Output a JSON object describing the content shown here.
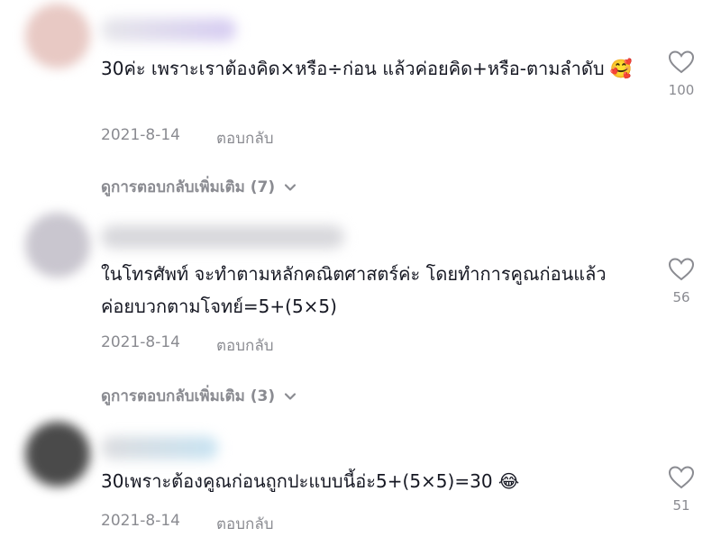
{
  "comments": [
    {
      "text": "30ค่ะ เพราะเราต้องคิด×หรือ÷ก่อน แล้วค่อยคิด+หรือ-ตามลำดับ",
      "emoji": "🥰",
      "date": "2021-8-14",
      "reply_label": "ตอบกลับ",
      "likes": "100",
      "more_replies": "ดูการตอบกลับเพิ่มเติม (7)",
      "avatar_color": "#e8c9c4",
      "name_color": "#d6ccf2"
    },
    {
      "text": "ในโทรศัพท์ จะทำตามหลักคณิตศาสตร์ค่ะ โดยทำการคูณก่อนแล้วค่อยบวกตามโจทย์=5+(5×5)",
      "emoji": "",
      "date": "2021-8-14",
      "reply_label": "ตอบกลับ",
      "likes": "56",
      "more_replies": "ดูการตอบกลับเพิ่มเติม (3)",
      "avatar_color": "#c9c6cf",
      "name_color": "#d8d8dc"
    },
    {
      "text": "30เพราะต้องคูณก่อนถูกปะแบบนี้อ่ะ5+(5×5)=30",
      "emoji": "😂",
      "date": "2021-8-14",
      "reply_label": "ตอบกลับ",
      "likes": "51",
      "more_replies": "",
      "avatar_color": "#4a4a4a",
      "name_color": "#c7e3f2"
    }
  ]
}
